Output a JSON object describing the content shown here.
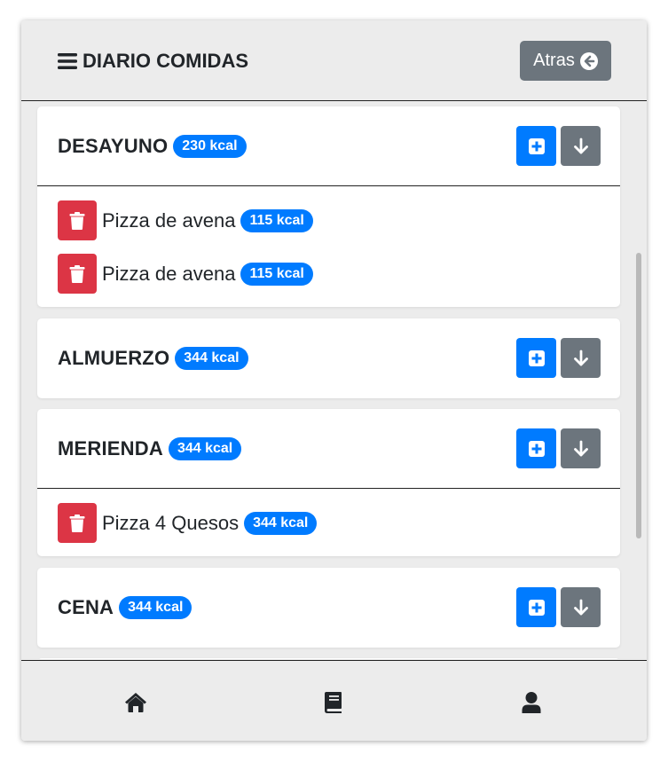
{
  "header": {
    "title": "DIARIO COMIDAS",
    "back_label": "Atras"
  },
  "meals": [
    {
      "title": "DESAYUNO",
      "kcal": "230 kcal",
      "items": [
        {
          "name": "Pizza de avena",
          "kcal": "115 kcal"
        },
        {
          "name": "Pizza de avena",
          "kcal": "115 kcal"
        }
      ]
    },
    {
      "title": "ALMUERZO",
      "kcal": "344 kcal",
      "items": []
    },
    {
      "title": "MERIENDA",
      "kcal": "344 kcal",
      "items": [
        {
          "name": "Pizza 4 Quesos",
          "kcal": "344 kcal"
        }
      ]
    },
    {
      "title": "CENA",
      "kcal": "344 kcal",
      "items": []
    }
  ],
  "bottom_nav": [
    "home-icon",
    "book-icon",
    "user-icon"
  ],
  "colors": {
    "primary": "#007bff",
    "secondary": "#6c757d",
    "danger": "#dc3545",
    "background": "#ececec"
  }
}
